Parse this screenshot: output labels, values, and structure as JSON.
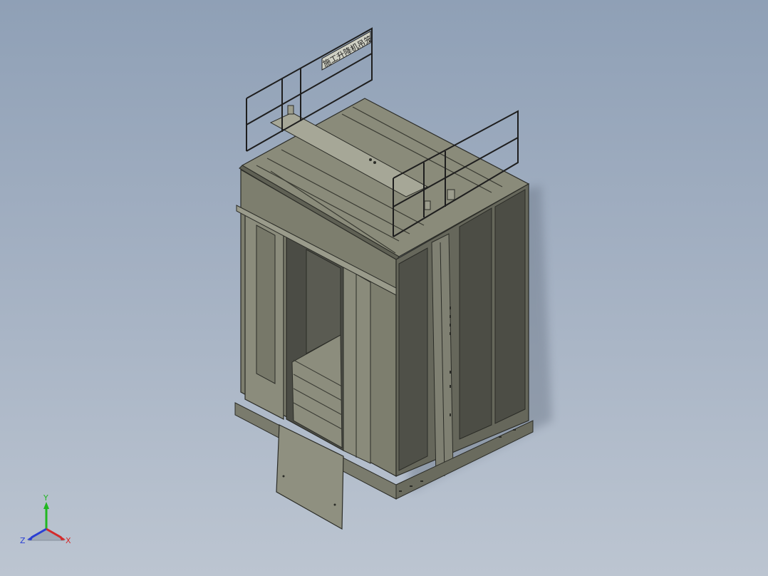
{
  "viewport": {
    "background_top": "#8fa0b6",
    "background_bottom": "#bcc5d1"
  },
  "model": {
    "name": "elevator-cage-assembly",
    "sign_text": "施工升降机吊笼",
    "colors": {
      "panel_light": "#8a8b7a",
      "panel_mid": "#727364",
      "panel_dark": "#55564c",
      "edge": "#2b2c27",
      "rail": "#1e1e1e"
    }
  },
  "triad": {
    "x_label": "X",
    "y_label": "Y",
    "z_label": "Z",
    "x_color": "#d42a2a",
    "y_color": "#21b721",
    "z_color": "#2a3fd4"
  }
}
